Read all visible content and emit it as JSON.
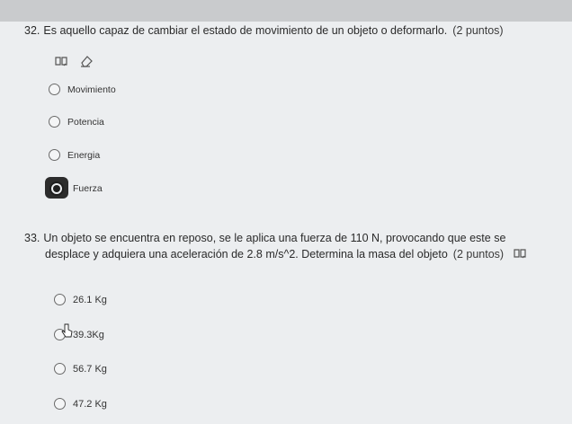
{
  "question_32": {
    "number": "32.",
    "text": "Es aquello capaz de cambiar el estado de movimiento de un objeto o deformarlo.",
    "points": "(2 puntos)",
    "options": [
      "Movimiento",
      "Potencia",
      "Energia",
      "Fuerza"
    ],
    "selected": "Fuerza",
    "icons": [
      "immersive-reader-icon",
      "eraser-icon"
    ]
  },
  "question_33": {
    "number": "33.",
    "text_line1": "Un objeto se encuentra en reposo, se le aplica una fuerza de 110 N, provocando que este se",
    "text_line2": "desplace y adquiera una aceleración de 2.8 m/s^2. Determina la masa del objeto",
    "points": "(2 puntos)",
    "options": [
      "26.1 Kg",
      "39.3Kg",
      "56.7 Kg",
      "47.2 Kg"
    ],
    "icons": [
      "immersive-reader-icon"
    ]
  }
}
